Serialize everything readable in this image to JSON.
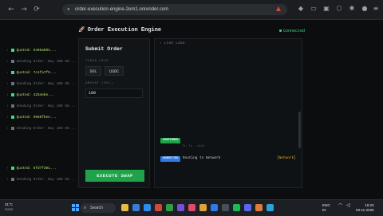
{
  "browser": {
    "url": "order-execution-engine-2em1.onrender.com",
    "nav_back": "←",
    "nav_forward": "→",
    "nav_reload": "⟳"
  },
  "app": {
    "title": "Order Execution Engine",
    "status": "Connected"
  },
  "order_panel": {
    "title": "Submit Order",
    "token_label": "TOKEN PAIR",
    "token_in": "SOL",
    "token_out": "USDC",
    "amount_label": "AMOUNT (SOL)",
    "amount_value": "100",
    "execute_label": "EXECUTE SWAP"
  },
  "log": {
    "header": "LIVE LOGS",
    "rows": [
      {
        "kind": "quote",
        "text": "Quoted: 9405ab91..."
      },
      {
        "kind": "send",
        "text": "Sending Order: Buy 100 SO..."
      },
      {
        "kind": "quote",
        "text": "Quoted: 7c1fa7f9..."
      },
      {
        "kind": "send",
        "text": "Sending Order: Buy 100 SO..."
      },
      {
        "kind": "quote",
        "text": "Quoted: 4254ebe..."
      },
      {
        "kind": "send",
        "text": "Sending Order: Buy 100 SO..."
      },
      {
        "kind": "quote",
        "text": "Quoted: 9960fbee..."
      },
      {
        "kind": "send",
        "text": "Sending Order: Buy 100 SO..."
      },
      {
        "kind": "send",
        "text": "Sending Order: Buy 100 SO..."
      }
    ],
    "confirmed_badge": "CONFIRMED",
    "confirmed_note": "TX: 5x...9k2m",
    "submitted_badge": "SUBMITTED",
    "submitted_route": "Routing to Network",
    "submitted_network": "[Network]",
    "tail_rows": [
      {
        "kind": "quote",
        "text": "Quoted: 8fd7f301..."
      },
      {
        "kind": "send",
        "text": "Sending Order: Buy 100 SO..."
      }
    ]
  },
  "taskbar": {
    "weather_temp": "31°C",
    "weather_desc": "Haze",
    "search_placeholder": "Search",
    "lang": "ENG",
    "lang_sub": "IN",
    "time": "16:22",
    "date": "03-11-2025"
  },
  "colors": {
    "accent_green": "#3ddc84",
    "execute_green": "#1fa34a",
    "submitted_blue": "#2f7ae5",
    "network_amber": "#e0b33a"
  }
}
